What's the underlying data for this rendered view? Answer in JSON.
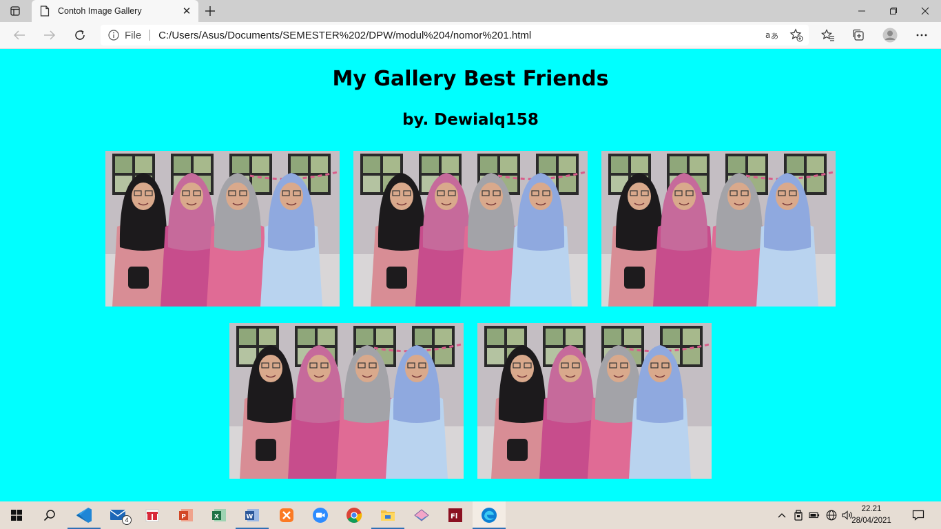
{
  "browser": {
    "tab": {
      "title": "Contoh Image Gallery"
    },
    "address": {
      "scheme": "File",
      "url": "C:/Users/Asus/Documents/SEMESTER%202/DPW/modul%204/nomor%201.html"
    }
  },
  "page": {
    "title": "My Gallery Best Friends",
    "subtitle": "by. Dewialq158",
    "background_color": "#00ffff",
    "photos": [
      {
        "name": "gallery-photo-1"
      },
      {
        "name": "gallery-photo-2"
      },
      {
        "name": "gallery-photo-3"
      },
      {
        "name": "gallery-photo-4"
      },
      {
        "name": "gallery-photo-5"
      }
    ]
  },
  "taskbar": {
    "mail_badge": "4",
    "clock": {
      "time": "22.21",
      "date": "28/04/2021"
    },
    "apps": [
      "windows-start",
      "search",
      "visual-studio-code",
      "mail",
      "gift-app",
      "powerpoint",
      "excel",
      "word",
      "xampp",
      "zoom",
      "chrome",
      "file-explorer",
      "app-12",
      "flash",
      "edge"
    ]
  }
}
